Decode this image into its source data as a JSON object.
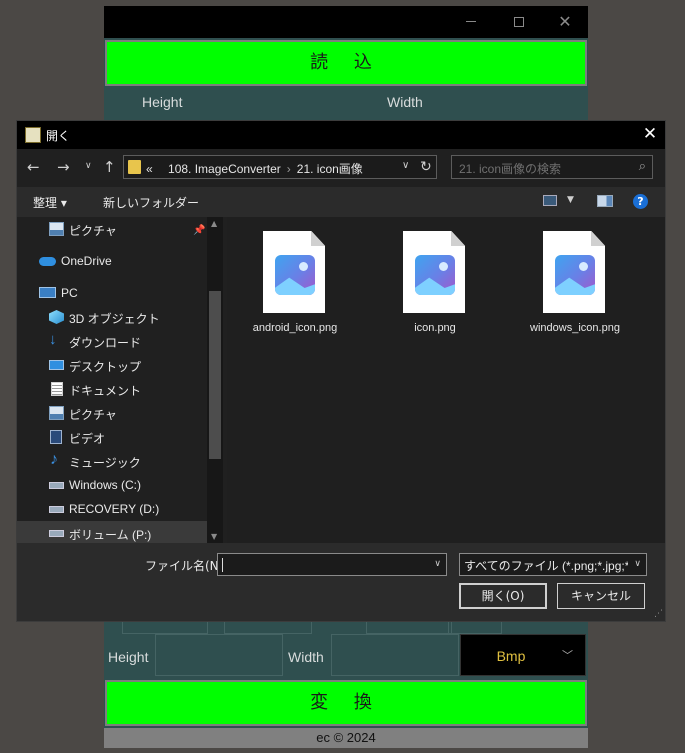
{
  "app": {
    "load_label": "読 込",
    "height_label": "Height",
    "width_label": "Width",
    "format_value": "Bmp",
    "convert_label": "変 換",
    "footer": "ec © 2024"
  },
  "dialog": {
    "title": "開く",
    "breadcrumb": [
      "«",
      "108. ImageConverter",
      "21. icon画像"
    ],
    "search_placeholder": "21. icon画像の検索",
    "organize_label": "整理 ▾",
    "new_folder_label": "新しいフォルダー",
    "sidebar": [
      {
        "label": "ピクチャ",
        "icon": "pictures-icon"
      },
      {
        "label": "OneDrive",
        "icon": "onedrive-icon"
      },
      {
        "label": "PC",
        "icon": "pc-icon"
      },
      {
        "label": "3D オブジェクト",
        "icon": "3d-objects-icon"
      },
      {
        "label": "ダウンロード",
        "icon": "download-icon"
      },
      {
        "label": "デスクトップ",
        "icon": "desktop-icon"
      },
      {
        "label": "ドキュメント",
        "icon": "documents-icon"
      },
      {
        "label": "ピクチャ",
        "icon": "pictures-icon"
      },
      {
        "label": "ビデオ",
        "icon": "video-icon"
      },
      {
        "label": "ミュージック",
        "icon": "music-icon"
      },
      {
        "label": "Windows (C:)",
        "icon": "drive-icon"
      },
      {
        "label": "RECOVERY (D:)",
        "icon": "drive-icon"
      },
      {
        "label": "ボリューム (P:)",
        "icon": "drive-icon"
      }
    ],
    "files": [
      {
        "name": "android_icon.png",
        "icon": "image-file-icon"
      },
      {
        "name": "icon.png",
        "icon": "image-file-icon"
      },
      {
        "name": "windows_icon.png",
        "icon": "image-file-icon"
      }
    ],
    "filename_label": "ファイル名(N):",
    "filename_value": "",
    "filter_value": "すべてのファイル (*.png;*.jpg;*.jpe",
    "open_label": "開く(O)",
    "cancel_label": "キャンセル"
  },
  "colors": {
    "app_bg": "#2f4f4f",
    "button_green": "#00ff00",
    "format_text": "#e0c040",
    "dialog_bg": "#202020",
    "help_blue": "#1a6fd6"
  }
}
